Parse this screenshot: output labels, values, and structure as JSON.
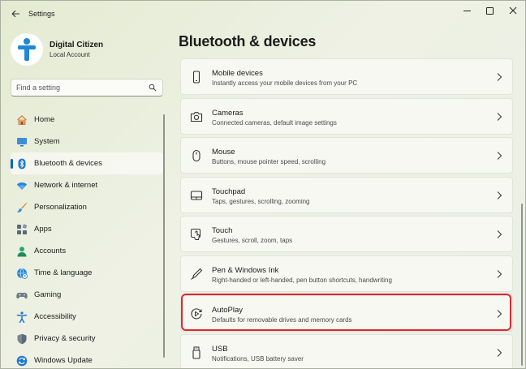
{
  "window": {
    "title": "Settings"
  },
  "profile": {
    "name": "Digital Citizen",
    "account_type": "Local Account"
  },
  "search": {
    "placeholder": "Find a setting"
  },
  "sidebar": {
    "items": [
      {
        "label": "Home",
        "icon": "home-icon"
      },
      {
        "label": "System",
        "icon": "system-icon"
      },
      {
        "label": "Bluetooth & devices",
        "icon": "bluetooth-icon",
        "active": true
      },
      {
        "label": "Network & internet",
        "icon": "wifi-icon"
      },
      {
        "label": "Personalization",
        "icon": "brush-icon"
      },
      {
        "label": "Apps",
        "icon": "apps-icon"
      },
      {
        "label": "Accounts",
        "icon": "accounts-icon"
      },
      {
        "label": "Time & language",
        "icon": "time-language-icon"
      },
      {
        "label": "Gaming",
        "icon": "gamepad-icon"
      },
      {
        "label": "Accessibility",
        "icon": "accessibility-icon"
      },
      {
        "label": "Privacy & security",
        "icon": "shield-icon"
      },
      {
        "label": "Windows Update",
        "icon": "update-icon"
      }
    ]
  },
  "main": {
    "title": "Bluetooth & devices",
    "cards": [
      {
        "title": "Mobile devices",
        "subtitle": "Instantly access your mobile devices from your PC",
        "icon": "phone-icon"
      },
      {
        "title": "Cameras",
        "subtitle": "Connected cameras, default image settings",
        "icon": "camera-icon"
      },
      {
        "title": "Mouse",
        "subtitle": "Buttons, mouse pointer speed, scrolling",
        "icon": "mouse-icon"
      },
      {
        "title": "Touchpad",
        "subtitle": "Taps, gestures, scrolling, zooming",
        "icon": "touchpad-icon"
      },
      {
        "title": "Touch",
        "subtitle": "Gestures, scroll, zoom, taps",
        "icon": "touch-icon"
      },
      {
        "title": "Pen & Windows Ink",
        "subtitle": "Right-handed or left-handed, pen button shortcuts, handwriting",
        "icon": "pen-icon"
      },
      {
        "title": "AutoPlay",
        "subtitle": "Defaults for removable drives and memory cards",
        "icon": "autoplay-icon",
        "highlighted": true
      },
      {
        "title": "USB",
        "subtitle": "Notifications, USB battery saver",
        "icon": "usb-icon"
      }
    ]
  },
  "colors": {
    "accent": "#0067c0",
    "highlight": "#e0262e"
  }
}
